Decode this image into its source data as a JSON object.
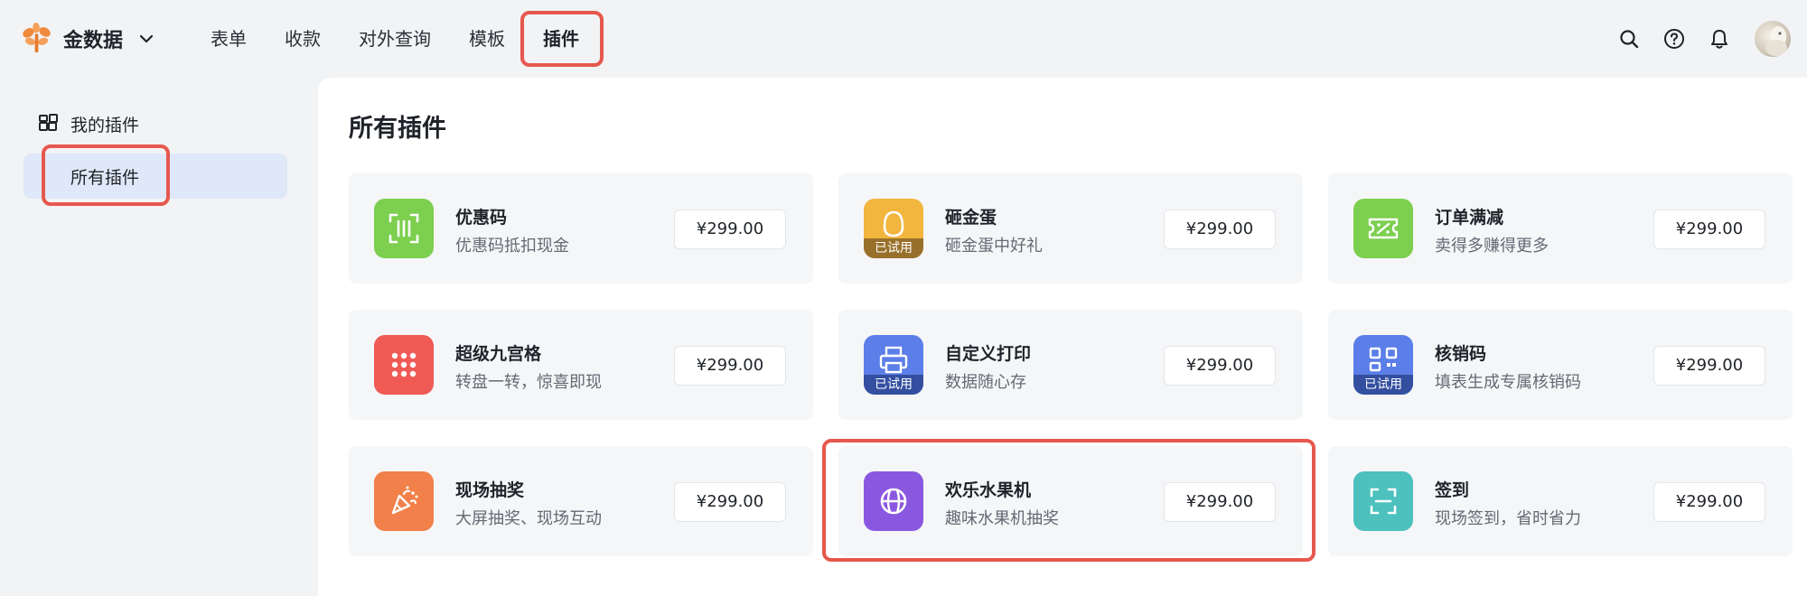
{
  "app": {
    "name": "金数据"
  },
  "nav": {
    "items": [
      "表单",
      "收款",
      "对外查询",
      "模板",
      "插件"
    ],
    "active_index": 4
  },
  "sidebar": {
    "group_label": "我的插件",
    "active_item": "所有插件"
  },
  "main": {
    "title": "所有插件",
    "plugins": [
      {
        "name": "优惠码",
        "desc": "优惠码抵扣现金",
        "price": "¥299.00",
        "icon": "coupon-scan-icon",
        "color": "#7ccf4f",
        "tried": ""
      },
      {
        "name": "砸金蛋",
        "desc": "砸金蛋中好礼",
        "price": "¥299.00",
        "icon": "golden-egg-icon",
        "color": "#f2b53d",
        "tried": "已试用"
      },
      {
        "name": "订单满减",
        "desc": "卖得多赚得更多",
        "price": "¥299.00",
        "icon": "ticket-discount-icon",
        "color": "#7ccf4f",
        "tried": ""
      },
      {
        "name": "超级九宫格",
        "desc": "转盘一转，惊喜即现",
        "price": "¥299.00",
        "icon": "nine-grid-icon",
        "color": "#ef5a55",
        "tried": ""
      },
      {
        "name": "自定义打印",
        "desc": "数据随心存",
        "price": "¥299.00",
        "icon": "printer-icon",
        "color": "#5b7ee8",
        "tried": "已试用"
      },
      {
        "name": "核销码",
        "desc": "填表生成专属核销码",
        "price": "¥299.00",
        "icon": "qr-code-icon",
        "color": "#5b7ee8",
        "tried": "已试用"
      },
      {
        "name": "现场抽奖",
        "desc": "大屏抽奖、现场互动",
        "price": "¥299.00",
        "icon": "party-popper-icon",
        "color": "#f2804a",
        "tried": ""
      },
      {
        "name": "欢乐水果机",
        "desc": "趣味水果机抽奖",
        "price": "¥299.00",
        "icon": "fruit-machine-icon",
        "color": "#8a58e0",
        "tried": ""
      },
      {
        "name": "签到",
        "desc": "现场签到，省时省力",
        "price": "¥299.00",
        "icon": "check-in-scan-icon",
        "color": "#4cc1bd",
        "tried": ""
      }
    ]
  },
  "colors": {
    "highlight": "#e6574d",
    "sidebar_active_bg": "#dfe8f8",
    "card_bg": "#f5f6f8"
  }
}
